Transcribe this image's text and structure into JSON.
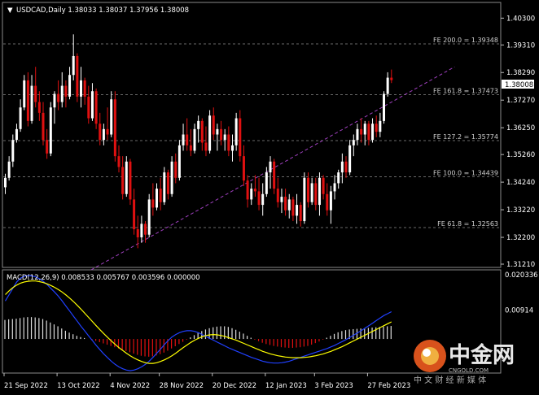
{
  "chart_data": {
    "type": "candlestick",
    "symbol_line": "USDCAD,Daily  1.38033 1.38037 1.37956 1.38008",
    "price_axis": {
      "ylim": [
        1.3112,
        1.4085
      ],
      "ticks": [
        "1.40300",
        "1.39310",
        "1.38290",
        "1.37270",
        "1.36250",
        "1.35260",
        "1.34240",
        "1.33220",
        "1.32200",
        "1.31210"
      ],
      "current_price": "1.38008"
    },
    "x_axis_labels": [
      "21 Sep 2022",
      "13 Oct 2022",
      "4 Nov 2022",
      "28 Nov 2022",
      "20 Dec 2022",
      "12 Jan 2023",
      "3 Feb 2023",
      "27 Feb 2023"
    ],
    "fibonacci_levels": [
      {
        "label": "FE 200.0 = 1.39348",
        "price": 1.39348
      },
      {
        "label": "FE 161.8 = 1.37473",
        "price": 1.37473
      },
      {
        "label": "FE 127.2 = 1.35774",
        "price": 1.35774
      },
      {
        "label": "FE 100.0 = 1.34439",
        "price": 1.34439
      },
      {
        "label": "FE 61.8 = 1.32563",
        "price": 1.32563
      }
    ],
    "trendline": {
      "from": {
        "bar": 23,
        "price": 1.31
      },
      "to": {
        "bar": 119,
        "price": 1.385
      }
    },
    "candles": [
      [
        1.3405,
        1.3455,
        1.338,
        1.344
      ],
      [
        1.344,
        1.352,
        1.343,
        1.35
      ],
      [
        1.35,
        1.36,
        1.348,
        1.358
      ],
      [
        1.358,
        1.364,
        1.357,
        1.362
      ],
      [
        1.362,
        1.373,
        1.361,
        1.37
      ],
      [
        1.37,
        1.382,
        1.369,
        1.38
      ],
      [
        1.38,
        1.383,
        1.363,
        1.365
      ],
      [
        1.365,
        1.382,
        1.364,
        1.378
      ],
      [
        1.378,
        1.385,
        1.37,
        1.372
      ],
      [
        1.372,
        1.376,
        1.365,
        1.368
      ],
      [
        1.368,
        1.372,
        1.356,
        1.358
      ],
      [
        1.358,
        1.362,
        1.351,
        1.353
      ],
      [
        1.353,
        1.372,
        1.352,
        1.37
      ],
      [
        1.37,
        1.376,
        1.364,
        1.375
      ],
      [
        1.375,
        1.38,
        1.369,
        1.372
      ],
      [
        1.372,
        1.383,
        1.37,
        1.378
      ],
      [
        1.378,
        1.38,
        1.37,
        1.374
      ],
      [
        1.374,
        1.385,
        1.373,
        1.382
      ],
      [
        1.382,
        1.397,
        1.38,
        1.389
      ],
      [
        1.389,
        1.39,
        1.372,
        1.374
      ],
      [
        1.374,
        1.385,
        1.37,
        1.38
      ],
      [
        1.38,
        1.381,
        1.371,
        1.374
      ],
      [
        1.374,
        1.378,
        1.364,
        1.366
      ],
      [
        1.366,
        1.379,
        1.365,
        1.376
      ],
      [
        1.376,
        1.377,
        1.362,
        1.364
      ],
      [
        1.364,
        1.368,
        1.356,
        1.358
      ],
      [
        1.358,
        1.364,
        1.356,
        1.362
      ],
      [
        1.362,
        1.37,
        1.358,
        1.36
      ],
      [
        1.36,
        1.376,
        1.359,
        1.373
      ],
      [
        1.373,
        1.376,
        1.35,
        1.352
      ],
      [
        1.352,
        1.356,
        1.346,
        1.348
      ],
      [
        1.348,
        1.352,
        1.336,
        1.338
      ],
      [
        1.338,
        1.352,
        1.337,
        1.35
      ],
      [
        1.35,
        1.351,
        1.334,
        1.336
      ],
      [
        1.336,
        1.34,
        1.323,
        1.325
      ],
      [
        1.325,
        1.33,
        1.318,
        1.322
      ],
      [
        1.322,
        1.33,
        1.32,
        1.327
      ],
      [
        1.327,
        1.328,
        1.32,
        1.323
      ],
      [
        1.323,
        1.338,
        1.322,
        1.336
      ],
      [
        1.336,
        1.342,
        1.33,
        1.333
      ],
      [
        1.333,
        1.342,
        1.332,
        1.34
      ],
      [
        1.34,
        1.344,
        1.332,
        1.335
      ],
      [
        1.335,
        1.348,
        1.334,
        1.346
      ],
      [
        1.346,
        1.347,
        1.336,
        1.338
      ],
      [
        1.338,
        1.352,
        1.337,
        1.35
      ],
      [
        1.35,
        1.353,
        1.342,
        1.344
      ],
      [
        1.344,
        1.358,
        1.343,
        1.356
      ],
      [
        1.356,
        1.364,
        1.354,
        1.36
      ],
      [
        1.36,
        1.366,
        1.354,
        1.356
      ],
      [
        1.356,
        1.362,
        1.352,
        1.354
      ],
      [
        1.354,
        1.364,
        1.353,
        1.362
      ],
      [
        1.362,
        1.367,
        1.357,
        1.365
      ],
      [
        1.365,
        1.366,
        1.354,
        1.357
      ],
      [
        1.357,
        1.363,
        1.352,
        1.354
      ],
      [
        1.354,
        1.369,
        1.353,
        1.367
      ],
      [
        1.367,
        1.37,
        1.358,
        1.36
      ],
      [
        1.36,
        1.364,
        1.354,
        1.362
      ],
      [
        1.362,
        1.365,
        1.356,
        1.358
      ],
      [
        1.358,
        1.362,
        1.354,
        1.36
      ],
      [
        1.36,
        1.363,
        1.352,
        1.354
      ],
      [
        1.354,
        1.36,
        1.35,
        1.356
      ],
      [
        1.356,
        1.368,
        1.354,
        1.366
      ],
      [
        1.366,
        1.369,
        1.35,
        1.352
      ],
      [
        1.352,
        1.356,
        1.341,
        1.343
      ],
      [
        1.343,
        1.345,
        1.333,
        1.336
      ],
      [
        1.336,
        1.342,
        1.334,
        1.34
      ],
      [
        1.34,
        1.345,
        1.337,
        1.339
      ],
      [
        1.339,
        1.344,
        1.332,
        1.334
      ],
      [
        1.334,
        1.342,
        1.33,
        1.338
      ],
      [
        1.338,
        1.348,
        1.337,
        1.346
      ],
      [
        1.346,
        1.352,
        1.34,
        1.35
      ],
      [
        1.35,
        1.351,
        1.338,
        1.34
      ],
      [
        1.34,
        1.344,
        1.333,
        1.335
      ],
      [
        1.335,
        1.34,
        1.331,
        1.337
      ],
      [
        1.337,
        1.34,
        1.33,
        1.332
      ],
      [
        1.332,
        1.338,
        1.329,
        1.336
      ],
      [
        1.336,
        1.337,
        1.328,
        1.33
      ],
      [
        1.33,
        1.338,
        1.327,
        1.334
      ],
      [
        1.334,
        1.335,
        1.326,
        1.328
      ],
      [
        1.328,
        1.346,
        1.327,
        1.344
      ],
      [
        1.344,
        1.346,
        1.333,
        1.335
      ],
      [
        1.335,
        1.344,
        1.334,
        1.342
      ],
      [
        1.342,
        1.344,
        1.332,
        1.334
      ],
      [
        1.334,
        1.346,
        1.33,
        1.344
      ],
      [
        1.344,
        1.345,
        1.336,
        1.338
      ],
      [
        1.338,
        1.342,
        1.33,
        1.332
      ],
      [
        1.332,
        1.341,
        1.327,
        1.339
      ],
      [
        1.339,
        1.345,
        1.336,
        1.342
      ],
      [
        1.342,
        1.347,
        1.34,
        1.346
      ],
      [
        1.346,
        1.353,
        1.342,
        1.35
      ],
      [
        1.35,
        1.352,
        1.344,
        1.346
      ],
      [
        1.346,
        1.358,
        1.345,
        1.356
      ],
      [
        1.356,
        1.36,
        1.352,
        1.358
      ],
      [
        1.358,
        1.364,
        1.356,
        1.362
      ],
      [
        1.362,
        1.366,
        1.357,
        1.36
      ],
      [
        1.36,
        1.365,
        1.356,
        1.364
      ],
      [
        1.364,
        1.365,
        1.356,
        1.358
      ],
      [
        1.358,
        1.366,
        1.357,
        1.364
      ],
      [
        1.364,
        1.367,
        1.359,
        1.361
      ],
      [
        1.361,
        1.368,
        1.359,
        1.365
      ],
      [
        1.365,
        1.376,
        1.364,
        1.375
      ],
      [
        1.375,
        1.383,
        1.374,
        1.381
      ],
      [
        1.381,
        1.384,
        1.379,
        1.3801
      ]
    ],
    "macd": {
      "label": "MACD(12,26,9)  0.008533 0.005767 0.003596 0.000000",
      "ylim": [
        -0.0105,
        0.0213
      ],
      "ticks": [
        "0.020336",
        "0.00914"
      ],
      "histogram": [
        0.006,
        0.0062,
        0.0063,
        0.0064,
        0.0066,
        0.0068,
        0.0069,
        0.0069,
        0.0068,
        0.0066,
        0.0063,
        0.0058,
        0.0052,
        0.0046,
        0.004,
        0.0033,
        0.0026,
        0.002,
        0.0015,
        0.001,
        0.0006,
        0.0003,
        0.0,
        -0.0003,
        -0.0006,
        -0.001,
        -0.0014,
        -0.0018,
        -0.0022,
        -0.0026,
        -0.003,
        -0.0034,
        -0.0038,
        -0.0042,
        -0.0046,
        -0.005,
        -0.0053,
        -0.0055,
        -0.0056,
        -0.0055,
        -0.0052,
        -0.0048,
        -0.0043,
        -0.0037,
        -0.003,
        -0.0023,
        -0.0016,
        -0.0009,
        -0.0002,
        0.0005,
        0.0012,
        0.0019,
        0.0025,
        0.003,
        0.0034,
        0.0037,
        0.0039,
        0.004,
        0.004,
        0.0038,
        0.0034,
        0.0029,
        0.0023,
        0.0017,
        0.001,
        0.0004,
        -0.0002,
        -0.0007,
        -0.0012,
        -0.0016,
        -0.0019,
        -0.0022,
        -0.0024,
        -0.0026,
        -0.0027,
        -0.0028,
        -0.0028,
        -0.0027,
        -0.0026,
        -0.0024,
        -0.0022,
        -0.0018,
        -0.0013,
        -0.0008,
        -0.0002,
        0.0004,
        0.001,
        0.0016,
        0.0021,
        0.0025,
        0.0028,
        0.003,
        0.0031,
        0.0032,
        0.0033,
        0.0034,
        0.0035,
        0.0036,
        0.0037,
        0.0038,
        0.0039,
        0.004,
        0.0041
      ],
      "signal": [
        0.014,
        0.0152,
        0.0162,
        0.017,
        0.0176,
        0.018,
        0.0182,
        0.0183,
        0.0183,
        0.0181,
        0.0178,
        0.0174,
        0.0169,
        0.0163,
        0.0156,
        0.0148,
        0.0139,
        0.0129,
        0.0118,
        0.0106,
        0.0094,
        0.0081,
        0.0068,
        0.0055,
        0.0042,
        0.0029,
        0.0017,
        0.0005,
        -0.0006,
        -0.0017,
        -0.0027,
        -0.0036,
        -0.0045,
        -0.0053,
        -0.006,
        -0.0066,
        -0.0071,
        -0.0075,
        -0.0077,
        -0.0077,
        -0.0075,
        -0.0071,
        -0.0066,
        -0.006,
        -0.0053,
        -0.0045,
        -0.0036,
        -0.0027,
        -0.0019,
        -0.0011,
        -0.0004,
        0.0002,
        0.0007,
        0.0011,
        0.0013,
        0.0014,
        0.0013,
        0.0011,
        0.0008,
        0.0004,
        0.0,
        -0.0004,
        -0.0009,
        -0.0014,
        -0.0019,
        -0.0024,
        -0.0029,
        -0.0034,
        -0.0039,
        -0.0043,
        -0.0047,
        -0.005,
        -0.0053,
        -0.0055,
        -0.0057,
        -0.0058,
        -0.0059,
        -0.0059,
        -0.0059,
        -0.0058,
        -0.0057,
        -0.0055,
        -0.0053,
        -0.005,
        -0.0047,
        -0.0043,
        -0.0039,
        -0.0034,
        -0.0029,
        -0.0024,
        -0.0018,
        -0.0012,
        -0.0006,
        0.0,
        0.0006,
        0.0012,
        0.0018,
        0.0024,
        0.003,
        0.0036,
        0.0042,
        0.0048,
        0.0054
      ],
      "macd_line": [
        0.012,
        0.014,
        0.016,
        0.018,
        0.0192,
        0.0198,
        0.02,
        0.0199,
        0.0196,
        0.019,
        0.0182,
        0.0172,
        0.016,
        0.0148,
        0.0135,
        0.012,
        0.0104,
        0.0088,
        0.0072,
        0.0056,
        0.004,
        0.0025,
        0.001,
        -0.0005,
        -0.002,
        -0.0034,
        -0.0047,
        -0.0059,
        -0.007,
        -0.008,
        -0.0088,
        -0.0094,
        -0.0098,
        -0.01,
        -0.0098,
        -0.0094,
        -0.0088,
        -0.008,
        -0.007,
        -0.0058,
        -0.0045,
        -0.0032,
        -0.0018,
        -0.0005,
        0.0006,
        0.0014,
        0.002,
        0.0024,
        0.0026,
        0.0026,
        0.0024,
        0.002,
        0.0014,
        0.0008,
        0.0002,
        -0.0004,
        -0.001,
        -0.0016,
        -0.0022,
        -0.0028,
        -0.0033,
        -0.0038,
        -0.0043,
        -0.0048,
        -0.0053,
        -0.0058,
        -0.0062,
        -0.0066,
        -0.007,
        -0.0073,
        -0.0075,
        -0.0076,
        -0.0076,
        -0.0075,
        -0.0073,
        -0.007,
        -0.0066,
        -0.0062,
        -0.0058,
        -0.0054,
        -0.005,
        -0.0046,
        -0.0042,
        -0.0038,
        -0.0034,
        -0.003,
        -0.0025,
        -0.002,
        -0.0014,
        -0.0008,
        -0.0002,
        0.0005,
        0.0012,
        0.0019,
        0.0026,
        0.0034,
        0.0042,
        0.005,
        0.0058,
        0.0066,
        0.0074,
        0.008,
        0.0086
      ]
    },
    "colors": {
      "bull": "#ffffff",
      "bear": "#e01010",
      "grid": "#6a6a6a",
      "trend": "#a040c0",
      "signal": "#ffff00",
      "macd_line": "#2040ff",
      "price_tag_bg": "#ffffff",
      "price_tag_text": "#000000"
    }
  },
  "watermark": {
    "brand": "中金网",
    "domain": "CNGOLD.COM",
    "slogan": "中 文 财 经 新 媒 体"
  }
}
